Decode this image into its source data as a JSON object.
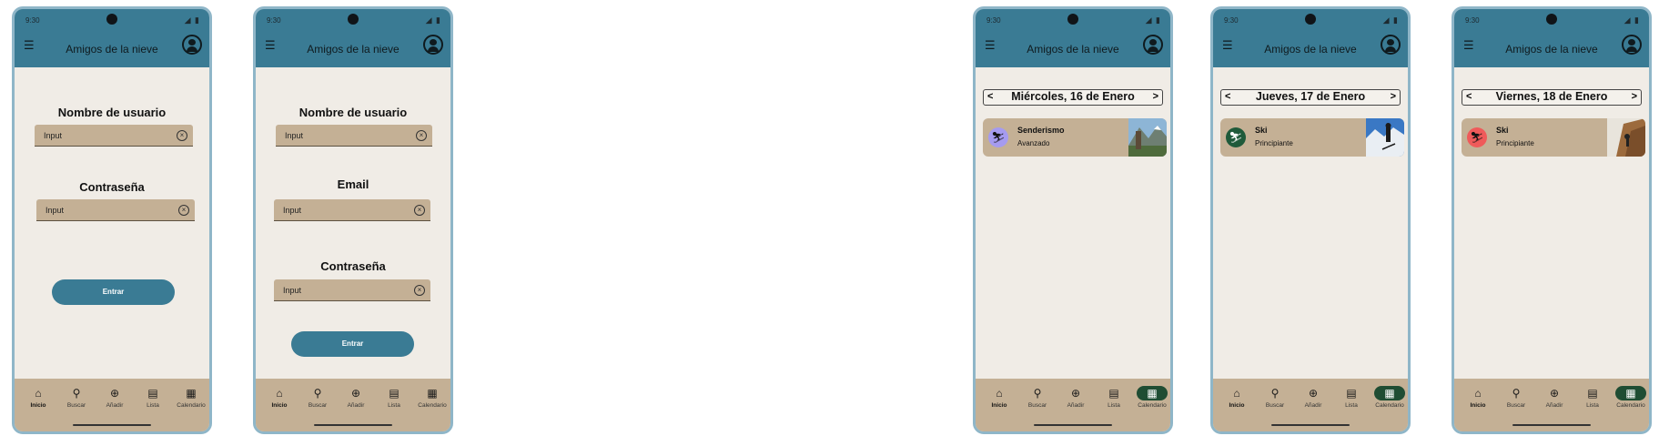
{
  "app": {
    "status_time": "9:30",
    "title": "Amigos de la nieve"
  },
  "nav": [
    {
      "label": "Inicio",
      "icon": "home-icon",
      "glyph": "⌂"
    },
    {
      "label": "Buscar",
      "icon": "search-icon",
      "glyph": "⚲"
    },
    {
      "label": "Añadir",
      "icon": "add-circle-icon",
      "glyph": "⊕"
    },
    {
      "label": "Lista",
      "icon": "clipboard-list-icon",
      "glyph": "▤"
    },
    {
      "label": "Calendario",
      "icon": "calendar-icon",
      "glyph": "▦"
    }
  ],
  "login": {
    "username_label": "Nombre de usuario",
    "password_label": "Contraseña",
    "input_placeholder": "Input",
    "enter_label": "Entrar"
  },
  "register": {
    "username_label": "Nombre de usuario",
    "email_label": "Email",
    "password_label": "Contraseña",
    "input_placeholder": "Input",
    "enter_label": "Entrar"
  },
  "calendar": [
    {
      "date": "Miércoles, 16 de Enero",
      "activity": "Senderismo",
      "level": "Avanzado",
      "badge_color": "#a59bf0",
      "prev": "<",
      "next": ">"
    },
    {
      "date": "Jueves, 17 de Enero",
      "activity": "Ski",
      "level": "Principiante",
      "badge_color": "#1f5a3a",
      "prev": "<",
      "next": ">"
    },
    {
      "date": "Viernes, 18 de Enero",
      "activity": "Ski",
      "level": "Principiante",
      "badge_color": "#ef5a5a",
      "prev": "<",
      "next": ">"
    }
  ]
}
